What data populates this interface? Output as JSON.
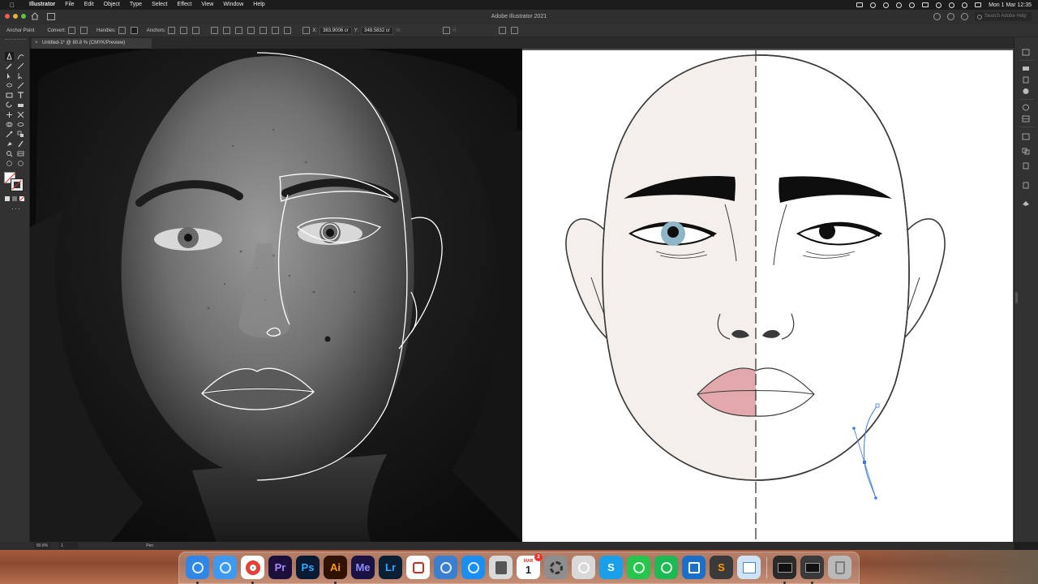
{
  "menubar": {
    "app_name": "Illustrator",
    "items": [
      "File",
      "Edit",
      "Object",
      "Type",
      "Select",
      "Effect",
      "View",
      "Window",
      "Help"
    ],
    "clock": "Mon 1 Mar  12:35"
  },
  "appbar": {
    "title": "Adobe Illustrator 2021",
    "search_placeholder": "Search Adobe Help"
  },
  "control_bar": {
    "tool_label": "Anchor Point",
    "convert_label": "Convert:",
    "handles_label": "Handles:",
    "anchors_label": "Anchors:",
    "x_label": "X:",
    "x_value": "383.9006 cr",
    "y_label": "Y:",
    "y_value": "348.5832 cr",
    "w_label": "W:",
    "h_label": "H:"
  },
  "document_tab": {
    "label": "Untitled-1* @ 80.8 % (CMYK/Preview)"
  },
  "status_bar": {
    "zoom": "80.8%",
    "page": "1",
    "tool": "Pen"
  },
  "dock": {
    "apps": [
      {
        "name": "Finder",
        "icon": "finder-icon",
        "color": "#2f86e6"
      },
      {
        "name": "Mail",
        "icon": "mail-icon",
        "color": "#3e9af0"
      },
      {
        "name": "Chrome",
        "icon": "chrome-icon",
        "color": "#ffffff"
      },
      {
        "name": "Premiere Pro",
        "label": "Pr",
        "color": "#1d0f3c",
        "text_color": "#a88cff"
      },
      {
        "name": "Photoshop",
        "label": "Ps",
        "color": "#0b1a33",
        "text_color": "#31a8ff"
      },
      {
        "name": "Illustrator",
        "label": "Ai",
        "color": "#2f1200",
        "text_color": "#ff9a00"
      },
      {
        "name": "Media Encoder",
        "label": "Me",
        "color": "#1a1240",
        "text_color": "#8f8cff"
      },
      {
        "name": "Lightroom",
        "label": "Lr",
        "color": "#0a1f33",
        "text_color": "#31a8ff"
      },
      {
        "name": "Acrobat",
        "icon": "acrobat-icon",
        "color": "#ffffff"
      },
      {
        "name": "Mail Migration",
        "icon": "wave-icon",
        "color": "#3a7fd0"
      },
      {
        "name": "App Store",
        "icon": "appstore-icon",
        "color": "#1b8ef2"
      },
      {
        "name": "Calculator",
        "icon": "calculator-icon",
        "color": "#d9d9d9"
      },
      {
        "name": "Calendar",
        "label": "1",
        "month": "MAR",
        "badge": "2",
        "color": "#ffffff"
      },
      {
        "name": "System Preferences",
        "icon": "gear-icon",
        "color": "#8e8e8e"
      },
      {
        "name": "QuickTime",
        "icon": "quicktime-icon",
        "color": "#d8d8d8"
      },
      {
        "name": "Skype",
        "label": "S",
        "color": "#1aa0e8",
        "text_color": "#ffffff"
      },
      {
        "name": "WhatsApp",
        "icon": "whatsapp-icon",
        "color": "#27c44e"
      },
      {
        "name": "Spotify",
        "icon": "spotify-icon",
        "color": "#1db954"
      },
      {
        "name": "Trello",
        "icon": "trello-icon",
        "color": "#1a6fc9"
      },
      {
        "name": "Sublime Text",
        "label": "S",
        "color": "#3a3a3a",
        "text_color": "#ff9800"
      },
      {
        "name": "Preview",
        "icon": "preview-icon",
        "color": "#cfe3f5"
      },
      {
        "name": "Screenshot Window",
        "icon": "window-icon",
        "color": "#2a2a2a"
      },
      {
        "name": "Screenshot Window 2",
        "icon": "window-icon",
        "color": "#3a3a3a"
      },
      {
        "name": "Trash",
        "icon": "trash-icon",
        "color": "#b9b9b9"
      }
    ]
  },
  "colors": {
    "skin_fill": "#f4efeb",
    "iris": "#8fb6c6",
    "lips": "#e2a8ac",
    "selection_blue": "#3f7bd6"
  }
}
